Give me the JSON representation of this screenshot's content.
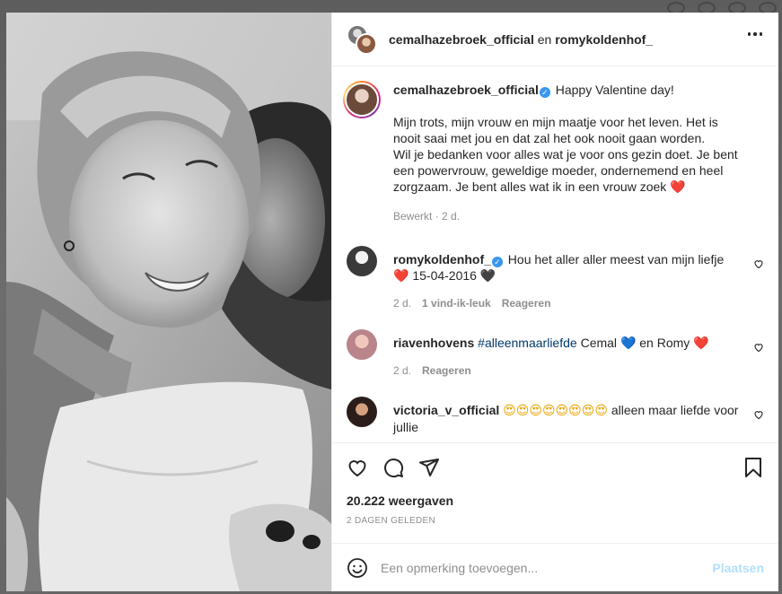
{
  "header": {
    "user1": "cemalhazebroek_official",
    "separator": "en",
    "user2": "romykoldenhof_",
    "more_icon": "more-horizontal-icon"
  },
  "caption": {
    "username": "cemalhazebroek_official",
    "first_line": "Happy Valentine day!",
    "body_1": "Mijn trots, mijn vrouw en mijn maatje voor het leven. Het is nooit saai met jou en dat zal het ook nooit gaan worden.",
    "body_2": "Wil je bedanken voor alles wat je voor ons gezin doet. Je bent een powervrouw, geweldige moeder, ondernemend en heel zorgzaam. Je bent alles wat ik in een vrouw zoek",
    "body_2_emoji": "❤️",
    "edited": "Bewerkt",
    "time": "2 d."
  },
  "comments": [
    {
      "username": "romykoldenhof_",
      "verified": true,
      "text_1": "Hou het aller aller meest van mijn liefje",
      "emoji_1": "❤️",
      "text_2": "15-04-2016",
      "emoji_2": "🖤",
      "time": "2 d.",
      "likes": "1 vind-ik-leuk",
      "reply": "Reageren"
    },
    {
      "username": "riavenhovens",
      "hashtag": "#alleenmaarliefde",
      "text_1": "Cemal",
      "emoji_1": "💙",
      "text_2": "en Romy",
      "emoji_2": "❤️",
      "time": "2 d.",
      "reply": "Reageren"
    },
    {
      "username": "victoria_v_official",
      "emojis": "😍😍😍😍😍😍😍😍",
      "text": "alleen maar liefde voor jullie"
    }
  ],
  "actions": {
    "like_icon": "heart-icon",
    "comment_icon": "comment-icon",
    "share_icon": "paper-plane-icon",
    "save_icon": "bookmark-icon"
  },
  "views": "20.222 weergaven",
  "date": "2 DAGEN GELEDEN",
  "comment_input": {
    "placeholder": "Een opmerking toevoegen...",
    "post_label": "Plaatsen",
    "emoji_icon": "smiley-icon"
  },
  "colors": {
    "verified": "#3897f0",
    "hashtag": "#00376b",
    "post_disabled": "#b2dffc",
    "muted": "#8e8e8e"
  }
}
